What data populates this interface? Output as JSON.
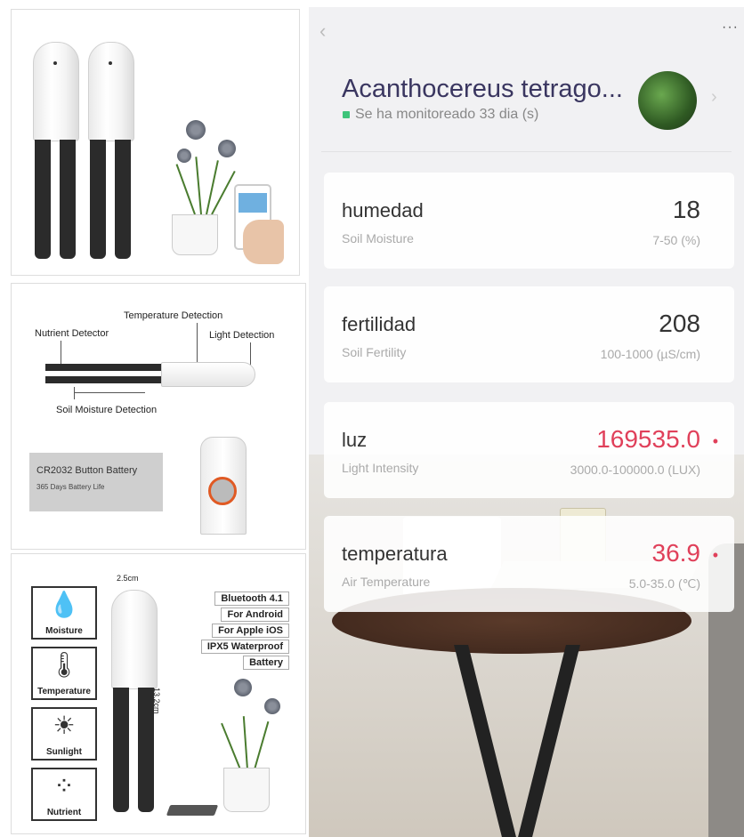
{
  "left_mid": {
    "temperature_detection": "Temperature Detection",
    "nutrient_detector": "Nutrient Detector",
    "light_detection": "Light Detection",
    "soil_moisture_detection": "Soil Moisture Detection",
    "battery_title": "CR2032 Button Battery",
    "battery_sub": "365 Days Battery Life"
  },
  "left_bot": {
    "width_label": "2.5cm",
    "height_label": "13.2cm",
    "icons": [
      {
        "glyph": "💧",
        "label": "Moisture"
      },
      {
        "glyph": "🌡",
        "label": "Temperature"
      },
      {
        "glyph": "☀",
        "label": "Sunlight"
      },
      {
        "glyph": "⁘",
        "label": "Nutrient"
      }
    ],
    "features": [
      "Bluetooth 4.1",
      "For Android",
      "For Apple iOS",
      "IPX5 Waterproof",
      "Battery"
    ]
  },
  "phone": {
    "back_icon": "chevron-left-icon",
    "more_label": "···",
    "plant_name": "Acanthocereus tetrago...",
    "monitor_status": "Se ha monitoreado 33 dia (s)",
    "status_color": "#3ec47a",
    "alert_color": "#e0405a",
    "metrics": [
      {
        "name": "humedad",
        "sub": "Soil Moisture",
        "value": "18",
        "range": "7-50 (%)",
        "alert": false
      },
      {
        "name": "fertilidad",
        "sub": "Soil Fertility",
        "value": "208",
        "range": "100-1000 (µS/cm)",
        "alert": false
      },
      {
        "name": "luz",
        "sub": "Light Intensity",
        "value": "169535.0",
        "range": "3000.0-100000.0 (LUX)",
        "alert": true
      },
      {
        "name": "temperatura",
        "sub": "Air Temperature",
        "value": "36.9",
        "range": "5.0-35.0 (℃)",
        "alert": true
      }
    ]
  }
}
